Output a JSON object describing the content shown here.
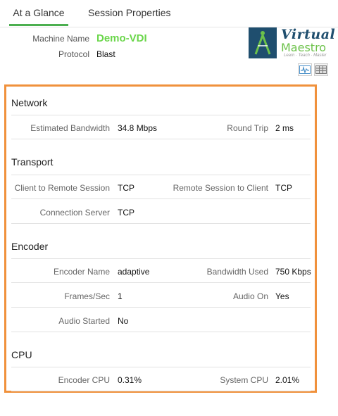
{
  "tabs": [
    {
      "label": "At a Glance"
    },
    {
      "label": "Session Properties"
    }
  ],
  "header": {
    "machine_label": "Machine Name",
    "machine_value": "Demo-VDI",
    "protocol_label": "Protocol",
    "protocol_value": "Blast"
  },
  "logo": {
    "line1": "Virtual",
    "line2": "Maestro",
    "tagline": "Learn · Teach · Master"
  },
  "colors": {
    "accent_tab": "#4caf50",
    "machine_name": "#6ad64a",
    "panel_border": "#f0913c",
    "logo_blue": "#1f4e6e",
    "logo_green": "#6cc24a"
  },
  "icons": {
    "chart_view": "chart-view-icon",
    "grid_view": "grid-view-icon"
  },
  "network": {
    "title": "Network",
    "bandwidth_label": "Estimated Bandwidth",
    "bandwidth_value": "34.8 Mbps",
    "rtt_label": "Round Trip",
    "rtt_value": "2 ms"
  },
  "transport": {
    "title": "Transport",
    "c2r_label": "Client to Remote Session",
    "c2r_value": "TCP",
    "r2c_label": "Remote Session to Client",
    "r2c_value": "TCP",
    "cs_label": "Connection Server",
    "cs_value": "TCP"
  },
  "encoder": {
    "title": "Encoder",
    "name_label": "Encoder Name",
    "name_value": "adaptive",
    "bw_label": "Bandwidth Used",
    "bw_value": "750 Kbps",
    "fps_label": "Frames/Sec",
    "fps_value": "1",
    "audio_on_label": "Audio On",
    "audio_on_value": "Yes",
    "audio_started_label": "Audio Started",
    "audio_started_value": "No"
  },
  "cpu": {
    "title": "CPU",
    "encoder_label": "Encoder CPU",
    "encoder_value": "0.31%",
    "system_label": "System CPU",
    "system_value": "2.01%"
  }
}
